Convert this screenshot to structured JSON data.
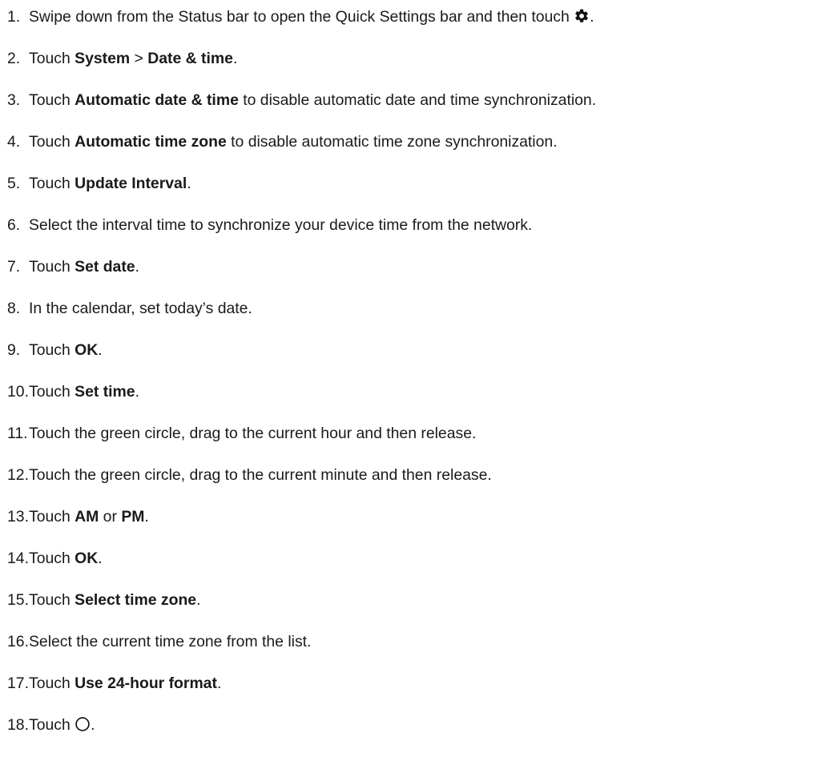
{
  "steps": [
    {
      "n": "1.",
      "parts": [
        {
          "t": "Swipe down from the Status bar to open the Quick Settings bar and then touch "
        },
        {
          "icon": "gear-icon"
        },
        {
          "t": "."
        }
      ]
    },
    {
      "n": "2.",
      "parts": [
        {
          "t": "Touch "
        },
        {
          "t": "System",
          "b": true
        },
        {
          "t": " > "
        },
        {
          "t": "Date & time",
          "b": true
        },
        {
          "t": "."
        }
      ]
    },
    {
      "n": "3.",
      "parts": [
        {
          "t": "Touch "
        },
        {
          "t": "Automatic date & time",
          "b": true
        },
        {
          "t": " to disable automatic date and time synchronization."
        }
      ]
    },
    {
      "n": "4.",
      "parts": [
        {
          "t": "Touch "
        },
        {
          "t": "Automatic time zone",
          "b": true
        },
        {
          "t": " to disable automatic time zone synchronization."
        }
      ]
    },
    {
      "n": "5.",
      "parts": [
        {
          "t": "Touch "
        },
        {
          "t": "Update Interval",
          "b": true
        },
        {
          "t": "."
        }
      ]
    },
    {
      "n": "6.",
      "parts": [
        {
          "t": "Select the interval time to synchronize your device time from the network."
        }
      ]
    },
    {
      "n": "7.",
      "parts": [
        {
          "t": "Touch "
        },
        {
          "t": "Set date",
          "b": true
        },
        {
          "t": "."
        }
      ]
    },
    {
      "n": "8.",
      "parts": [
        {
          "t": "In the calendar, set today’s date."
        }
      ]
    },
    {
      "n": "9.",
      "parts": [
        {
          "t": "Touch "
        },
        {
          "t": "OK",
          "b": true
        },
        {
          "t": "."
        }
      ]
    },
    {
      "n": "10.",
      "parts": [
        {
          "t": "Touch "
        },
        {
          "t": "Set time",
          "b": true
        },
        {
          "t": "."
        }
      ]
    },
    {
      "n": "11.",
      "parts": [
        {
          "t": "Touch the green circle, drag to the current hour and then release."
        }
      ]
    },
    {
      "n": "12.",
      "parts": [
        {
          "t": "Touch the green circle, drag to the current minute and then release."
        }
      ]
    },
    {
      "n": "13.",
      "parts": [
        {
          "t": "Touch "
        },
        {
          "t": "AM",
          "b": true
        },
        {
          "t": " or "
        },
        {
          "t": "PM",
          "b": true
        },
        {
          "t": "."
        }
      ]
    },
    {
      "n": "14.",
      "parts": [
        {
          "t": "Touch "
        },
        {
          "t": "OK",
          "b": true
        },
        {
          "t": "."
        }
      ]
    },
    {
      "n": "15.",
      "parts": [
        {
          "t": "Touch "
        },
        {
          "t": "Select time zone",
          "b": true
        },
        {
          "t": "."
        }
      ]
    },
    {
      "n": "16.",
      "parts": [
        {
          "t": "Select the current time zone from the list."
        }
      ]
    },
    {
      "n": "17.",
      "parts": [
        {
          "t": "Touch "
        },
        {
          "t": "Use 24-hour format",
          "b": true
        },
        {
          "t": "."
        }
      ]
    },
    {
      "n": "18.",
      "parts": [
        {
          "t": "Touch "
        },
        {
          "icon": "home-circle-icon"
        },
        {
          "t": "."
        }
      ]
    }
  ]
}
